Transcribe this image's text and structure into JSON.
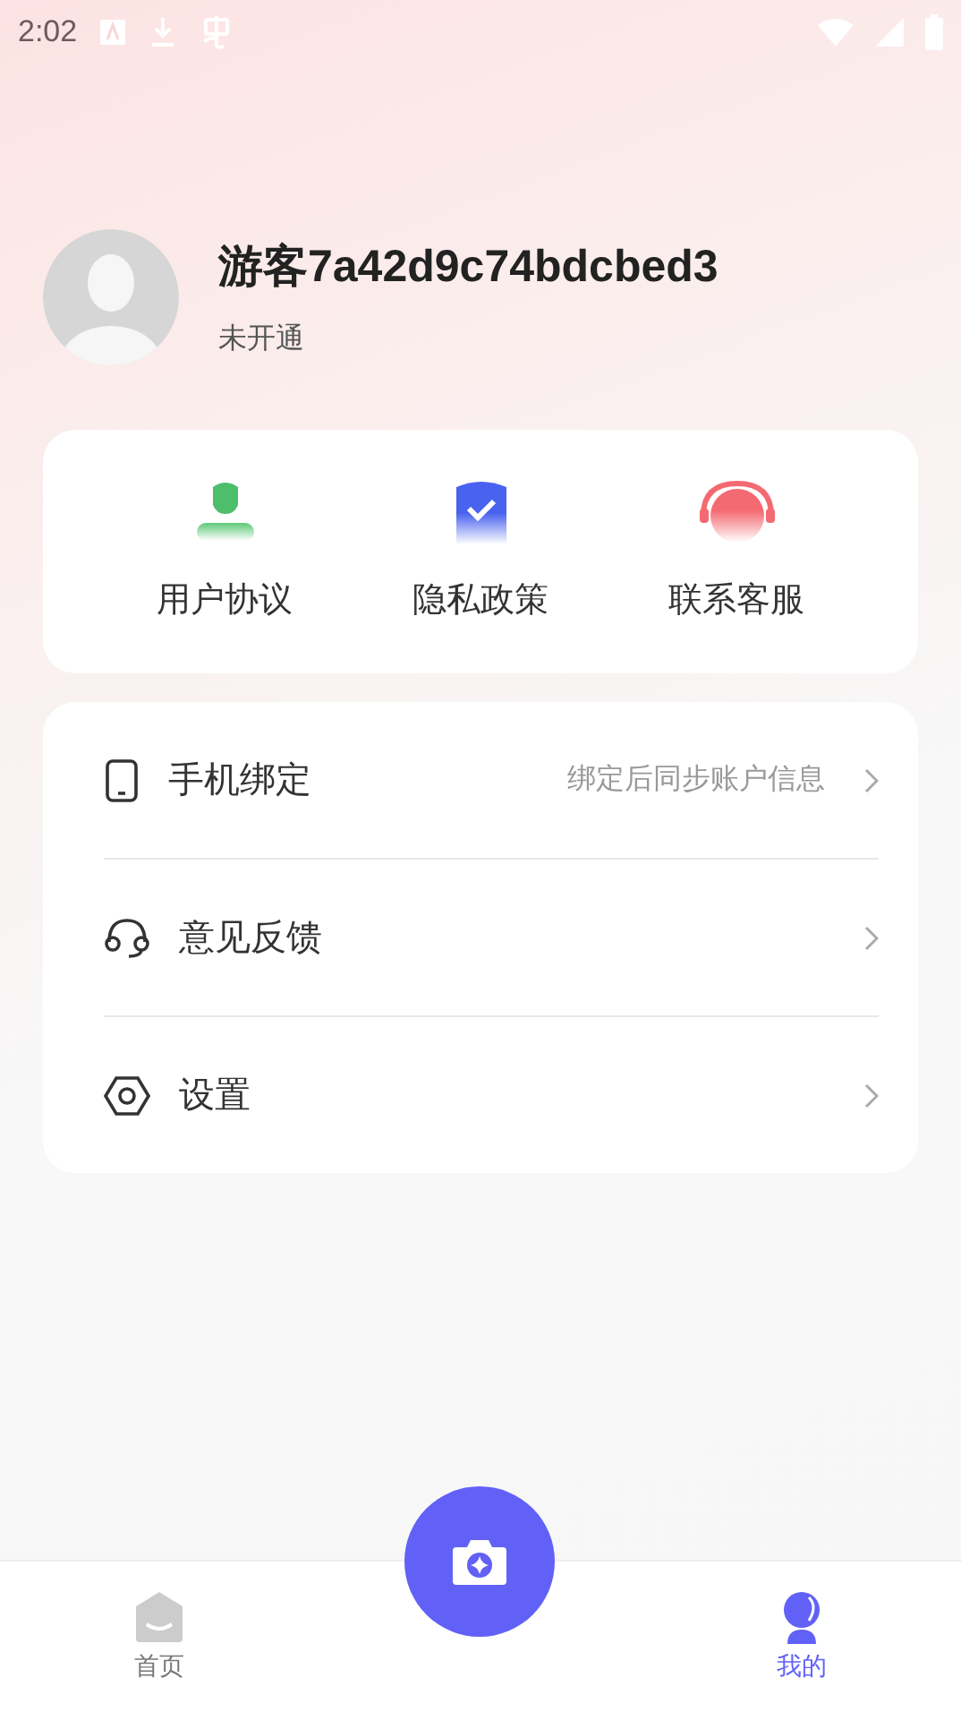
{
  "status_bar": {
    "time": "2:02"
  },
  "profile": {
    "name": "游客7a42d9c74bdcbed3",
    "status": "未开通"
  },
  "quick_links": [
    {
      "kind": "agreement",
      "label": "用户协议"
    },
    {
      "kind": "privacy",
      "label": "隐私政策"
    },
    {
      "kind": "service",
      "label": "联系客服"
    }
  ],
  "menu": [
    {
      "kind": "phone",
      "label": "手机绑定",
      "hint": "绑定后同步账户信息"
    },
    {
      "kind": "feedback",
      "label": "意见反馈"
    },
    {
      "kind": "settings",
      "label": "设置"
    }
  ],
  "bottom_nav": [
    {
      "kind": "home",
      "label": "首页",
      "selected": false
    },
    {
      "kind": "mine",
      "label": "我的",
      "selected": true
    }
  ]
}
